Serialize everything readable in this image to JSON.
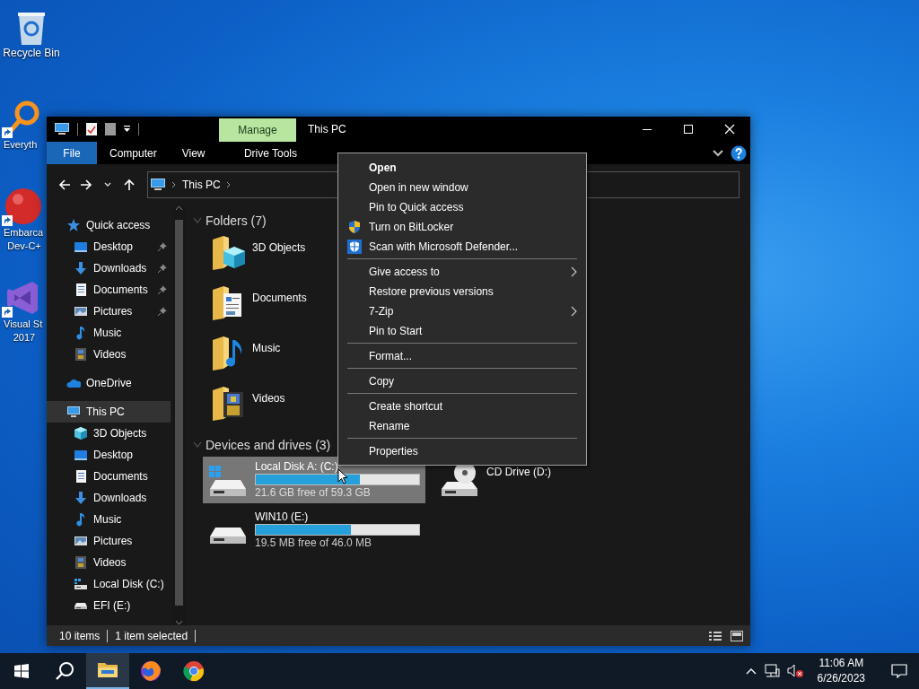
{
  "desktop_icons": [
    {
      "kind": "recycle",
      "lines": [
        "Recycle Bin"
      ]
    },
    {
      "kind": "magnifier",
      "lines": [
        "Everyth"
      ]
    },
    {
      "kind": "redball",
      "lines": [
        "Embarca",
        "Dev-C+"
      ]
    },
    {
      "kind": "vs",
      "lines": [
        "Visual St",
        "2017"
      ]
    }
  ],
  "window": {
    "title": "This PC",
    "context_tab": "Manage",
    "ribbon_tabs": [
      {
        "label": "File",
        "selected": true
      },
      {
        "label": "Computer",
        "selected": false
      },
      {
        "label": "View",
        "selected": false
      },
      {
        "label": "Drive Tools",
        "selected": false
      }
    ],
    "address": {
      "crumbs": [
        "This PC"
      ]
    },
    "sidebar": {
      "items": [
        {
          "label": "Quick access",
          "kind": "star",
          "selected": false,
          "children": [
            {
              "label": "Desktop",
              "kind": "desktop",
              "pinned": true,
              "selected": false
            },
            {
              "label": "Downloads",
              "kind": "download",
              "pinned": true,
              "selected": false
            },
            {
              "label": "Documents",
              "kind": "document",
              "pinned": true,
              "selected": false
            },
            {
              "label": "Pictures",
              "kind": "pictures",
              "pinned": true,
              "selected": false
            },
            {
              "label": "Music",
              "kind": "music",
              "pinned": false,
              "selected": false
            },
            {
              "label": "Videos",
              "kind": "videos",
              "pinned": false,
              "selected": false
            }
          ]
        },
        {
          "label": "OneDrive",
          "kind": "cloud",
          "selected": false
        },
        {
          "label": "This PC",
          "kind": "pc",
          "selected": true,
          "children": [
            {
              "label": "3D Objects",
              "kind": "cube",
              "selected": false
            },
            {
              "label": "Desktop",
              "kind": "desktop",
              "selected": false
            },
            {
              "label": "Documents",
              "kind": "document",
              "selected": false
            },
            {
              "label": "Downloads",
              "kind": "download",
              "selected": false
            },
            {
              "label": "Music",
              "kind": "music",
              "selected": false
            },
            {
              "label": "Pictures",
              "kind": "pictures",
              "selected": false
            },
            {
              "label": "Videos",
              "kind": "videos",
              "selected": false
            },
            {
              "label": "Local Disk (C:)",
              "kind": "sysdisk",
              "selected": false
            },
            {
              "label": "EFI (E:)",
              "kind": "disk",
              "selected": false
            }
          ]
        }
      ]
    },
    "folders": {
      "header": "Folders (7)",
      "items": [
        {
          "label": "3D Objects",
          "kind": "cube"
        },
        {
          "label": "Documents",
          "kind": "document"
        },
        {
          "label": "Music",
          "kind": "music"
        },
        {
          "label": "Videos",
          "kind": "videos"
        }
      ]
    },
    "drives": {
      "header": "Devices and drives (3)",
      "items": [
        {
          "name": "Local Disk A: (C:)",
          "kind": "system",
          "level": 0.64,
          "free": "21.6 GB free of 59.3 GB",
          "selected": true
        },
        {
          "name": "CD Drive (D:)",
          "kind": "cd",
          "selected": false
        },
        {
          "name": "WIN10 (E:)",
          "kind": "removable",
          "level": 0.58,
          "free": "19.5 MB free of 46.0 MB",
          "selected": false
        }
      ]
    },
    "status_bar": [
      "10 items",
      "1 item selected"
    ]
  },
  "context_menu": {
    "groups": [
      [
        {
          "label": "Open",
          "kind": "default",
          "submenu": false
        },
        {
          "label": "Open in new window",
          "kind": "plain",
          "submenu": false
        },
        {
          "label": "Pin to Quick access",
          "kind": "plain",
          "submenu": false
        },
        {
          "label": "Turn on BitLocker",
          "kind": "uac",
          "submenu": false
        },
        {
          "label": "Scan with Microsoft Defender...",
          "kind": "shield",
          "submenu": false
        }
      ],
      [
        {
          "label": "Give access to",
          "kind": "plain",
          "submenu": true
        },
        {
          "label": "Restore previous versions",
          "kind": "plain",
          "submenu": false
        },
        {
          "label": "7-Zip",
          "kind": "plain",
          "submenu": true
        },
        {
          "label": "Pin to Start",
          "kind": "plain",
          "submenu": false
        }
      ],
      [
        {
          "label": "Format...",
          "kind": "plain",
          "submenu": false
        }
      ],
      [
        {
          "label": "Copy",
          "kind": "plain",
          "submenu": false
        }
      ],
      [
        {
          "label": "Create shortcut",
          "kind": "plain",
          "submenu": false
        },
        {
          "label": "Rename",
          "kind": "plain",
          "submenu": false
        }
      ],
      [
        {
          "label": "Properties",
          "kind": "plain",
          "submenu": false
        }
      ]
    ]
  },
  "taskbar": {
    "apps": [
      {
        "kind": "explorer",
        "selected": true
      },
      {
        "kind": "firefox",
        "selected": false
      },
      {
        "kind": "chrome",
        "selected": false
      }
    ],
    "time": "11:06 AM",
    "date": "6/26/2023"
  }
}
